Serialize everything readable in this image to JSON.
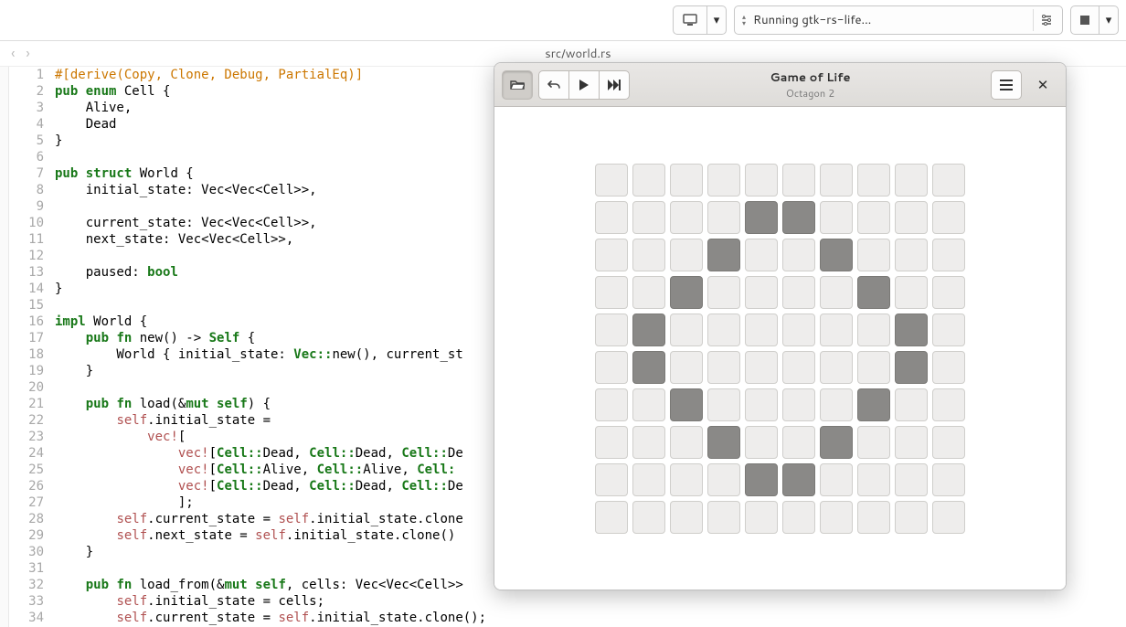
{
  "toolbar": {
    "running_text": "Running gtk-rs-life…"
  },
  "file": {
    "path": "src/world.rs"
  },
  "code": {
    "lines": [
      {
        "n": 1,
        "segs": [
          {
            "t": "#[derive(Copy, Clone, Debug, PartialEq)]",
            "c": "tok-attr"
          }
        ]
      },
      {
        "n": 2,
        "segs": [
          {
            "t": "pub ",
            "c": "tok-kw"
          },
          {
            "t": "enum ",
            "c": "tok-kw"
          },
          {
            "t": "Cell {",
            "c": ""
          }
        ]
      },
      {
        "n": 3,
        "segs": [
          {
            "t": "    Alive,",
            "c": ""
          }
        ]
      },
      {
        "n": 4,
        "segs": [
          {
            "t": "    Dead",
            "c": ""
          }
        ]
      },
      {
        "n": 5,
        "segs": [
          {
            "t": "}",
            "c": ""
          }
        ]
      },
      {
        "n": 6,
        "segs": [
          {
            "t": "",
            "c": ""
          }
        ]
      },
      {
        "n": 7,
        "segs": [
          {
            "t": "pub ",
            "c": "tok-kw"
          },
          {
            "t": "struct ",
            "c": "tok-kw"
          },
          {
            "t": "World {",
            "c": ""
          }
        ]
      },
      {
        "n": 8,
        "segs": [
          {
            "t": "    initial_state: Vec<Vec<Cell>>,",
            "c": ""
          }
        ]
      },
      {
        "n": 9,
        "segs": [
          {
            "t": "",
            "c": ""
          }
        ]
      },
      {
        "n": 10,
        "segs": [
          {
            "t": "    current_state: Vec<Vec<Cell>>,",
            "c": ""
          }
        ]
      },
      {
        "n": 11,
        "segs": [
          {
            "t": "    next_state: Vec<Vec<Cell>>,",
            "c": ""
          }
        ]
      },
      {
        "n": 12,
        "segs": [
          {
            "t": "",
            "c": ""
          }
        ]
      },
      {
        "n": 13,
        "segs": [
          {
            "t": "    paused: ",
            "c": ""
          },
          {
            "t": "bool",
            "c": "tok-kw"
          }
        ]
      },
      {
        "n": 14,
        "segs": [
          {
            "t": "}",
            "c": ""
          }
        ]
      },
      {
        "n": 15,
        "segs": [
          {
            "t": "",
            "c": ""
          }
        ]
      },
      {
        "n": 16,
        "segs": [
          {
            "t": "impl ",
            "c": "tok-kw"
          },
          {
            "t": "World {",
            "c": ""
          }
        ]
      },
      {
        "n": 17,
        "segs": [
          {
            "t": "    ",
            "c": ""
          },
          {
            "t": "pub ",
            "c": "tok-kw"
          },
          {
            "t": "fn ",
            "c": "tok-kw"
          },
          {
            "t": "new() -> ",
            "c": ""
          },
          {
            "t": "Self ",
            "c": "tok-type"
          },
          {
            "t": "{",
            "c": ""
          }
        ]
      },
      {
        "n": 18,
        "segs": [
          {
            "t": "        World { initial_state: ",
            "c": ""
          },
          {
            "t": "Vec::",
            "c": "tok-path"
          },
          {
            "t": "new(), current_st",
            "c": ""
          }
        ]
      },
      {
        "n": 19,
        "segs": [
          {
            "t": "    }",
            "c": ""
          }
        ]
      },
      {
        "n": 20,
        "segs": [
          {
            "t": "",
            "c": ""
          }
        ]
      },
      {
        "n": 21,
        "segs": [
          {
            "t": "    ",
            "c": ""
          },
          {
            "t": "pub ",
            "c": "tok-kw"
          },
          {
            "t": "fn ",
            "c": "tok-kw"
          },
          {
            "t": "load(&",
            "c": ""
          },
          {
            "t": "mut ",
            "c": "tok-kw"
          },
          {
            "t": "self",
            "c": "tok-kw"
          },
          {
            "t": ") {",
            "c": ""
          }
        ]
      },
      {
        "n": 22,
        "segs": [
          {
            "t": "        ",
            "c": ""
          },
          {
            "t": "self",
            "c": "tok-self"
          },
          {
            "t": ".initial_state =",
            "c": ""
          }
        ]
      },
      {
        "n": 23,
        "segs": [
          {
            "t": "            ",
            "c": ""
          },
          {
            "t": "vec!",
            "c": "tok-macro"
          },
          {
            "t": "[",
            "c": ""
          }
        ]
      },
      {
        "n": 24,
        "segs": [
          {
            "t": "                ",
            "c": ""
          },
          {
            "t": "vec!",
            "c": "tok-macro"
          },
          {
            "t": "[",
            "c": ""
          },
          {
            "t": "Cell::",
            "c": "tok-path"
          },
          {
            "t": "Dead, ",
            "c": ""
          },
          {
            "t": "Cell::",
            "c": "tok-path"
          },
          {
            "t": "Dead, ",
            "c": ""
          },
          {
            "t": "Cell::",
            "c": "tok-path"
          },
          {
            "t": "De",
            "c": ""
          }
        ]
      },
      {
        "n": 25,
        "segs": [
          {
            "t": "                ",
            "c": ""
          },
          {
            "t": "vec!",
            "c": "tok-macro"
          },
          {
            "t": "[",
            "c": ""
          },
          {
            "t": "Cell::",
            "c": "tok-path"
          },
          {
            "t": "Alive, ",
            "c": ""
          },
          {
            "t": "Cell::",
            "c": "tok-path"
          },
          {
            "t": "Alive, ",
            "c": ""
          },
          {
            "t": "Cell:",
            "c": "tok-path"
          }
        ]
      },
      {
        "n": 26,
        "segs": [
          {
            "t": "                ",
            "c": ""
          },
          {
            "t": "vec!",
            "c": "tok-macro"
          },
          {
            "t": "[",
            "c": ""
          },
          {
            "t": "Cell::",
            "c": "tok-path"
          },
          {
            "t": "Dead, ",
            "c": ""
          },
          {
            "t": "Cell::",
            "c": "tok-path"
          },
          {
            "t": "Dead, ",
            "c": ""
          },
          {
            "t": "Cell::",
            "c": "tok-path"
          },
          {
            "t": "De",
            "c": ""
          }
        ]
      },
      {
        "n": 27,
        "segs": [
          {
            "t": "                ];",
            "c": ""
          }
        ]
      },
      {
        "n": 28,
        "segs": [
          {
            "t": "        ",
            "c": ""
          },
          {
            "t": "self",
            "c": "tok-self"
          },
          {
            "t": ".current_state = ",
            "c": ""
          },
          {
            "t": "self",
            "c": "tok-self"
          },
          {
            "t": ".initial_state.clone",
            "c": ""
          }
        ]
      },
      {
        "n": 29,
        "segs": [
          {
            "t": "        ",
            "c": ""
          },
          {
            "t": "self",
            "c": "tok-self"
          },
          {
            "t": ".next_state = ",
            "c": ""
          },
          {
            "t": "self",
            "c": "tok-self"
          },
          {
            "t": ".initial_state.clone()",
            "c": ""
          }
        ]
      },
      {
        "n": 30,
        "segs": [
          {
            "t": "    }",
            "c": ""
          }
        ]
      },
      {
        "n": 31,
        "segs": [
          {
            "t": "",
            "c": ""
          }
        ]
      },
      {
        "n": 32,
        "segs": [
          {
            "t": "    ",
            "c": ""
          },
          {
            "t": "pub ",
            "c": "tok-kw"
          },
          {
            "t": "fn ",
            "c": "tok-kw"
          },
          {
            "t": "load_from(&",
            "c": ""
          },
          {
            "t": "mut ",
            "c": "tok-kw"
          },
          {
            "t": "self",
            "c": "tok-kw"
          },
          {
            "t": ", cells: Vec<Vec<Cell>>",
            "c": ""
          }
        ]
      },
      {
        "n": 33,
        "segs": [
          {
            "t": "        ",
            "c": ""
          },
          {
            "t": "self",
            "c": "tok-self"
          },
          {
            "t": ".initial_state = cells;",
            "c": ""
          }
        ]
      },
      {
        "n": 34,
        "segs": [
          {
            "t": "        ",
            "c": ""
          },
          {
            "t": "self",
            "c": "tok-self"
          },
          {
            "t": ".current_state = ",
            "c": ""
          },
          {
            "t": "self",
            "c": "tok-self"
          },
          {
            "t": ".initial_state.clone();",
            "c": ""
          }
        ]
      }
    ]
  },
  "gol": {
    "title": "Game of Life",
    "subtitle": "Octagon 2",
    "grid": [
      [
        0,
        0,
        0,
        0,
        0,
        0,
        0,
        0,
        0,
        0
      ],
      [
        0,
        0,
        0,
        0,
        1,
        1,
        0,
        0,
        0,
        0
      ],
      [
        0,
        0,
        0,
        1,
        0,
        0,
        1,
        0,
        0,
        0
      ],
      [
        0,
        0,
        1,
        0,
        0,
        0,
        0,
        1,
        0,
        0
      ],
      [
        0,
        1,
        0,
        0,
        0,
        0,
        0,
        0,
        1,
        0
      ],
      [
        0,
        1,
        0,
        0,
        0,
        0,
        0,
        0,
        1,
        0
      ],
      [
        0,
        0,
        1,
        0,
        0,
        0,
        0,
        1,
        0,
        0
      ],
      [
        0,
        0,
        0,
        1,
        0,
        0,
        1,
        0,
        0,
        0
      ],
      [
        0,
        0,
        0,
        0,
        1,
        1,
        0,
        0,
        0,
        0
      ],
      [
        0,
        0,
        0,
        0,
        0,
        0,
        0,
        0,
        0,
        0
      ]
    ]
  }
}
